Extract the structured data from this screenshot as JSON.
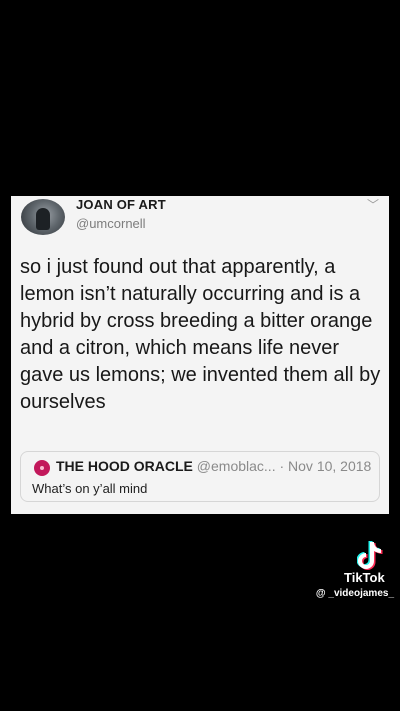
{
  "tweet": {
    "display_name": "JOAN OF ART",
    "handle": "@umcornell",
    "text": "so i just found out that apparently, a lemon isn’t naturally occurring and is a hybrid by cross breeding a bitter orange and a citron, which means life never gave us lemons; we invented them all by ourselves",
    "caret_icon": "chevron-down-icon"
  },
  "quoted_tweet": {
    "display_name": "THE HOOD ORACLE",
    "handle": "@emoblac...",
    "date": "· Nov 10, 2018",
    "text": "What’s on y’all mind",
    "avatar_color": "#c2185b"
  },
  "watermark": {
    "brand": "TikTok",
    "username": "@ _videojames_"
  },
  "colors": {
    "background": "#000000",
    "card": "#f4f4f4"
  }
}
